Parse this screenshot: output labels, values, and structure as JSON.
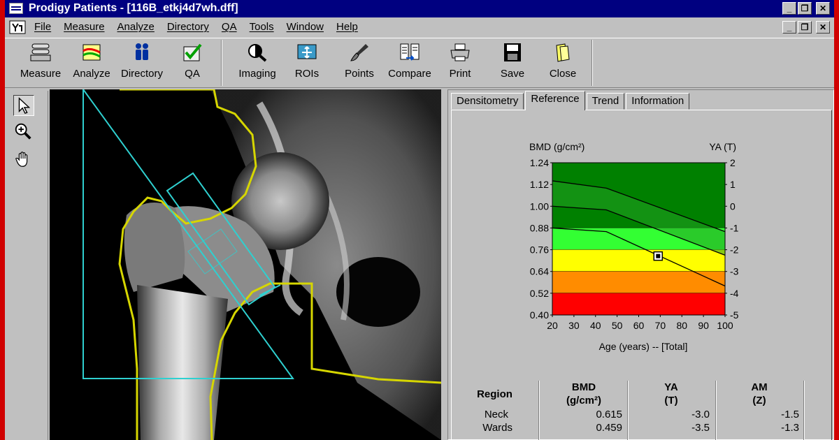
{
  "window": {
    "title": "Prodigy Patients - [116B_etkj4d7wh.dff]"
  },
  "menu": [
    "File",
    "Measure",
    "Analyze",
    "Directory",
    "QA",
    "Tools",
    "Window",
    "Help"
  ],
  "toolbar": {
    "measure": "Measure",
    "analyze": "Analyze",
    "directory": "Directory",
    "qa": "QA",
    "imaging": "Imaging",
    "rois": "ROIs",
    "points": "Points",
    "compare": "Compare",
    "print": "Print",
    "save": "Save",
    "close": "Close"
  },
  "tabs": {
    "densitometry": "Densitometry",
    "reference": "Reference",
    "trend": "Trend",
    "information": "Information"
  },
  "colors": {
    "dark_green": "#008000",
    "green": "#22a022",
    "light_green": "#33ff33",
    "yellow": "#ffff00",
    "orange": "#ff8c00",
    "red": "#ff0000",
    "roi_cyan": "#2fd0d0",
    "contour_yellow": "#d6d600"
  },
  "chart_data": {
    "type": "line",
    "ylabel_left": "BMD (g/cm²)",
    "ylabel_right": "YA (T)",
    "xlabel": "Age (years) -- [Total]",
    "x_ticks": [
      "20",
      "30",
      "40",
      "50",
      "60",
      "70",
      "80",
      "90",
      "100"
    ],
    "y_ticks_left": [
      "1.24",
      "1.12",
      "1.00",
      "0.88",
      "0.76",
      "0.64",
      "0.52",
      "0.40"
    ],
    "y_ticks_right": [
      "2",
      "1",
      "0",
      "-1",
      "-2",
      "-3",
      "-4",
      "-5"
    ],
    "xlim": [
      20,
      100
    ],
    "ylim": [
      0.4,
      1.24
    ],
    "bands": [
      {
        "from": 0.88,
        "to": 1.24,
        "color": "#008000"
      },
      {
        "from": 0.76,
        "to": 0.88,
        "color": "#33ff33"
      },
      {
        "from": 0.64,
        "to": 0.76,
        "color": "#ffff00"
      },
      {
        "from": 0.52,
        "to": 0.64,
        "color": "#ff8c00"
      },
      {
        "from": 0.4,
        "to": 0.52,
        "color": "#ff0000"
      }
    ],
    "curves": [
      {
        "x": [
          20,
          45,
          100
        ],
        "y": [
          1.14,
          1.1,
          0.86
        ]
      },
      {
        "x": [
          20,
          45,
          100
        ],
        "y": [
          1.0,
          0.98,
          0.73
        ]
      },
      {
        "x": [
          20,
          45,
          100
        ],
        "y": [
          0.88,
          0.86,
          0.56
        ]
      }
    ],
    "patient_point": {
      "x": 69,
      "y": 0.725
    }
  },
  "results": {
    "headers": {
      "region": "Region",
      "bmd": [
        "BMD",
        "(g/cm²)"
      ],
      "ya": [
        "YA",
        "(T)"
      ],
      "am": [
        "AM",
        "(Z)"
      ]
    },
    "rows": [
      {
        "region": "Neck",
        "bmd": "0.615",
        "ya": "-3.0",
        "am": "-1.5"
      },
      {
        "region": "Wards",
        "bmd": "0.459",
        "ya": "-3.5",
        "am": "-1.3"
      }
    ]
  }
}
